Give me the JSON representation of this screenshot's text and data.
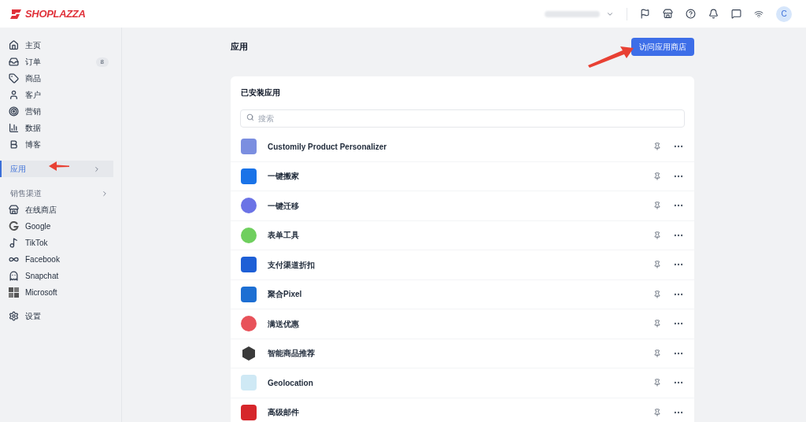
{
  "header": {
    "logo": "SHOPLAZZA",
    "avatar": "C"
  },
  "sidebar": {
    "items": [
      {
        "label": "主页",
        "selected": false
      },
      {
        "label": "订单",
        "badge": "8",
        "selected": false
      },
      {
        "label": "商品",
        "selected": false
      },
      {
        "label": "客户",
        "selected": false
      },
      {
        "label": "营销",
        "selected": false
      },
      {
        "label": "数据",
        "selected": false
      },
      {
        "label": "博客",
        "selected": false
      },
      {
        "label": "应用",
        "chevron": true,
        "selected": true
      }
    ],
    "channels_heading": "销售渠道",
    "channels": [
      {
        "label": "在线商店"
      },
      {
        "label": "Google"
      },
      {
        "label": "TikTok"
      },
      {
        "label": "Facebook"
      },
      {
        "label": "Snapchat"
      },
      {
        "label": "Microsoft"
      }
    ],
    "settings": "设置"
  },
  "page": {
    "title": "应用",
    "store_button": "访问应用商店"
  },
  "installed": {
    "heading": "已安装应用",
    "search": {
      "placeholder": "搜索"
    },
    "apps": [
      {
        "name": "Customily Product Personalizer",
        "kind": "square",
        "color": "#7b8ee0"
      },
      {
        "name": "一键搬家",
        "kind": "square",
        "color": "#1a73e8"
      },
      {
        "name": "一键迁移",
        "kind": "circle",
        "color": "#6b73e6"
      },
      {
        "name": "表单工具",
        "kind": "circle",
        "color": "#6fcf5e"
      },
      {
        "name": "支付渠道折扣",
        "kind": "square",
        "color": "#1e5fd6"
      },
      {
        "name": "聚合Pixel",
        "kind": "square",
        "color": "#1d6fd3"
      },
      {
        "name": "满送优惠",
        "kind": "circle",
        "color": "#e8525a"
      },
      {
        "name": "智能商品推荐",
        "kind": "hexagon",
        "color": "#3a3a3a"
      },
      {
        "name": "Geolocation",
        "kind": "square",
        "color": "#cfe9f5"
      },
      {
        "name": "高级邮件",
        "kind": "square",
        "color": "#d6262b"
      }
    ]
  }
}
